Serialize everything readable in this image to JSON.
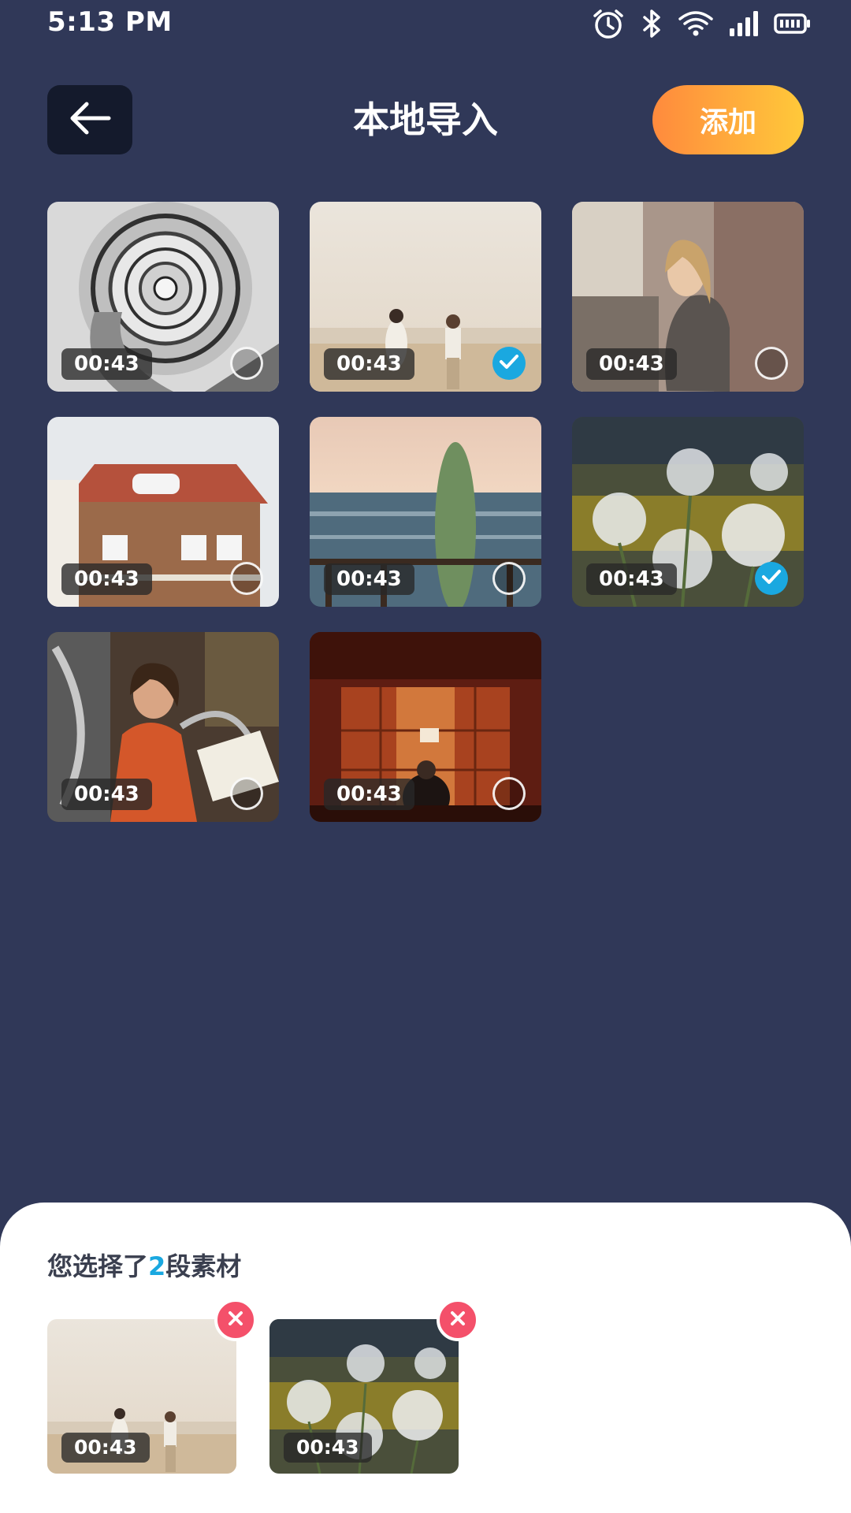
{
  "status_bar": {
    "time": "5:13 PM",
    "icons": [
      "alarm-icon",
      "bluetooth-icon",
      "wifi-icon",
      "signal-icon",
      "battery-icon"
    ]
  },
  "header": {
    "back_icon": "arrow-left-icon",
    "title": "本地导入",
    "add_label": "添加"
  },
  "media": [
    {
      "scene": "spiral-staircase",
      "duration": "00:43",
      "selected": false
    },
    {
      "scene": "beach-couple",
      "duration": "00:43",
      "selected": true
    },
    {
      "scene": "woman-portrait",
      "duration": "00:43",
      "selected": false
    },
    {
      "scene": "timber-house",
      "duration": "00:43",
      "selected": false
    },
    {
      "scene": "surfboard-sea",
      "duration": "00:43",
      "selected": false
    },
    {
      "scene": "white-flowers",
      "duration": "00:43",
      "selected": true
    },
    {
      "scene": "woman-reading",
      "duration": "00:43",
      "selected": false
    },
    {
      "scene": "red-lockers",
      "duration": "00:43",
      "selected": false
    }
  ],
  "selection": {
    "prefix": "您选择了",
    "count": "2",
    "suffix": "段素材",
    "items": [
      {
        "scene": "beach-couple",
        "duration": "00:43"
      },
      {
        "scene": "white-flowers",
        "duration": "00:43"
      }
    ]
  },
  "colors": {
    "background": "#303858",
    "accent_check": "#1aa8e0",
    "add_gradient_start": "#ff8a3d",
    "add_gradient_end": "#ffc93a",
    "remove": "#f4506a"
  }
}
